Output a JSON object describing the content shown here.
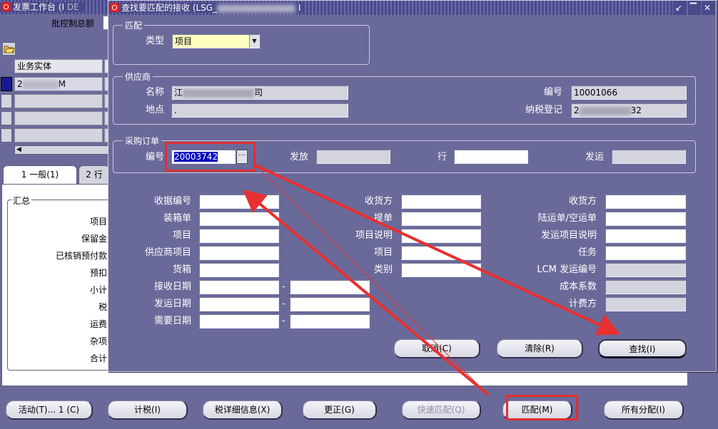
{
  "background_window": {
    "title": "发票工作台 (I",
    "title_suffix": "DE",
    "batch_total_label": "批控制总额",
    "table_header": "业务实体",
    "row1_value_prefix": "2",
    "row1_value_suffix": "M",
    "tab1": "1 一般(1)",
    "tab2": "2 行",
    "summary_label": "汇总",
    "summary_items": [
      "项目",
      "保留金",
      "已核销预付款",
      "预扣",
      "小计",
      "税",
      "运费",
      "杂项",
      "合计"
    ]
  },
  "dialog": {
    "title": "查找要匹配的接收 (LSG_",
    "title_suffix": "I",
    "match_group": {
      "title": "匹配",
      "type_label": "类型",
      "type_value": "项目"
    },
    "supplier_group": {
      "title": "供应商",
      "name_label": "名称",
      "name_prefix": "江",
      "name_suffix": "司",
      "site_label": "地点",
      "site_value": ".",
      "number_label": "编号",
      "number_value": "10001066",
      "tax_label": "纳税登记",
      "tax_prefix": "2",
      "tax_suffix": "32"
    },
    "po_group": {
      "title": "采购订单",
      "number_label": "编号",
      "number_value": "20003742",
      "release_label": "发放",
      "line_label": "行",
      "shipment_label": "发运"
    },
    "fields_col1": [
      "收据编号",
      "装箱单",
      "项目",
      "供应商项目",
      "货箱",
      "接收日期",
      "发运日期",
      "需要日期"
    ],
    "fields_col2": [
      "收货方",
      "提单",
      "项目说明",
      "项目",
      "类别"
    ],
    "fields_col3": [
      "收货方",
      "陆运单/空运单",
      "发运项目说明",
      "任务",
      "LCM 发运编号",
      "成本系数",
      "计费方"
    ],
    "date_separator": "-",
    "buttons": {
      "cancel": "取消(C)",
      "clear": "清除(R)",
      "find": "查找(I)"
    }
  },
  "bottom_buttons": {
    "actions": "活动(T)... 1 (C)",
    "calc_tax": "计税(I)",
    "tax_details": "税详细信息(X)",
    "correct": "更正(G)",
    "quick_match": "快速匹配(Q)",
    "match": "匹配(M)",
    "all_distributions": "所有分配(I)"
  },
  "colors": {
    "window_bg": "#6a6a9a",
    "highlight_red": "#e03030",
    "selection_blue": "#0000c0",
    "dropdown_yellow": "#ffffc0"
  }
}
